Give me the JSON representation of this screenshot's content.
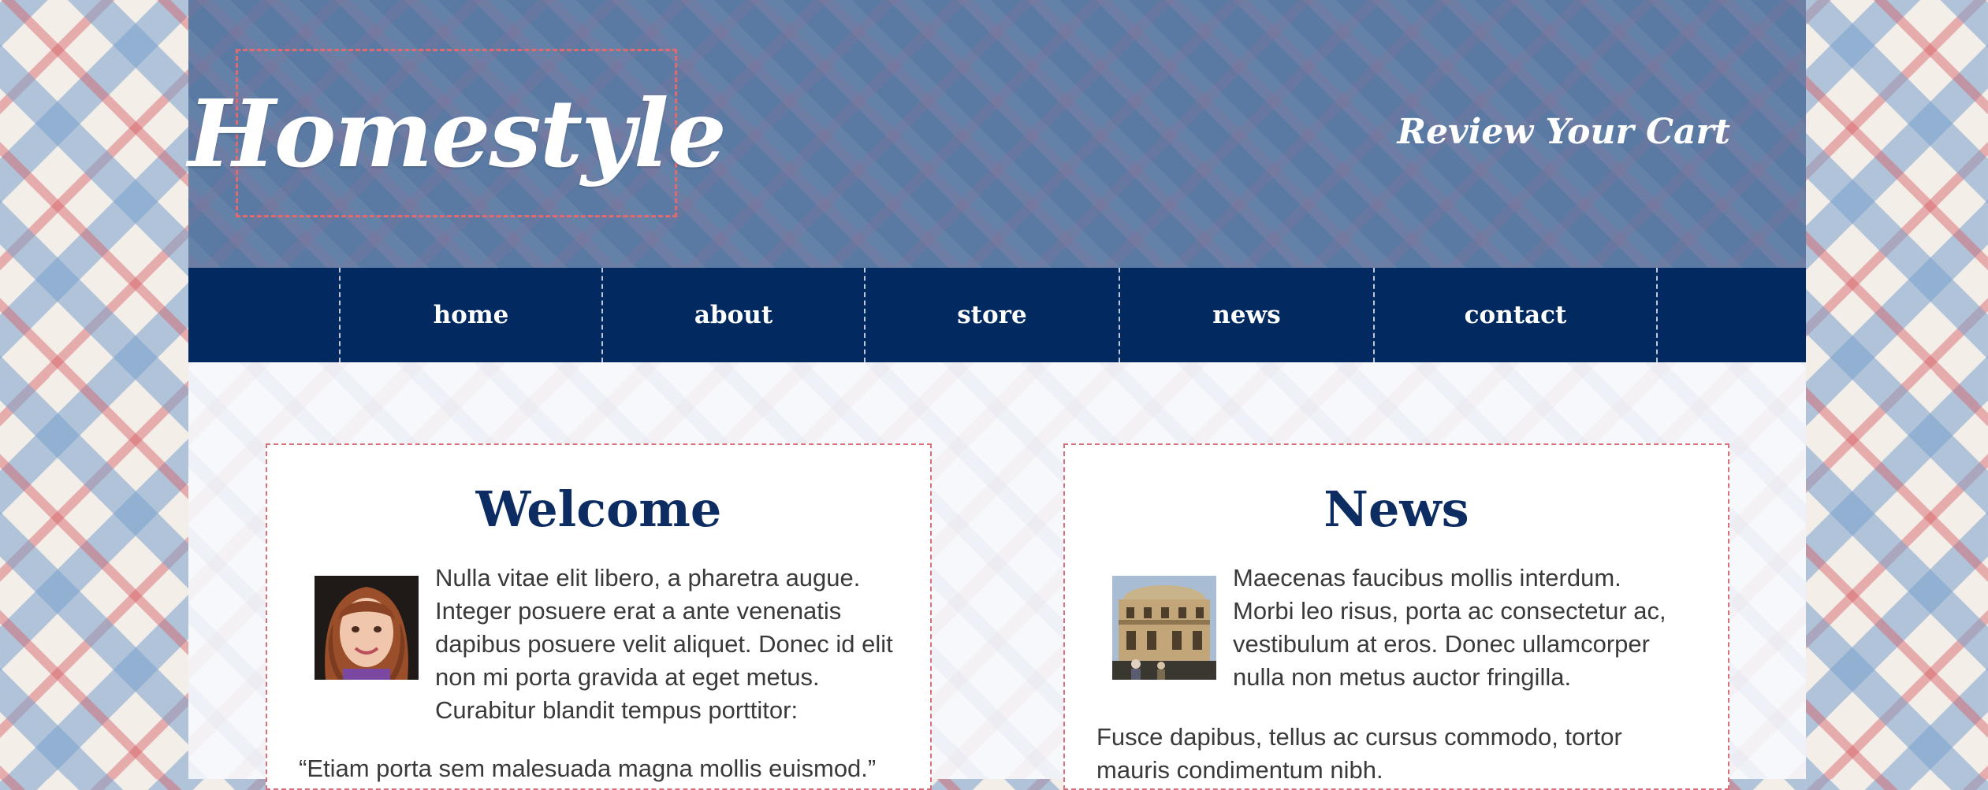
{
  "header": {
    "logo": "Homestyle",
    "cart_link": "Review Your Cart"
  },
  "nav": [
    {
      "label": "home"
    },
    {
      "label": "about"
    },
    {
      "label": "store"
    },
    {
      "label": "news"
    },
    {
      "label": "contact"
    }
  ],
  "welcome": {
    "title": "Welcome",
    "lines": [
      "Nulla vitae elit libero, a pharetra augue.",
      "Integer posuere erat a ante venenatis",
      "dapibus posuere velit aliquet. Donec id elit",
      "non mi porta gravida at eget metus.",
      "Curabitur blandit tempus porttitor:"
    ],
    "quote": "“Etiam porta sem malesuada magna mollis euismod.”",
    "image": "portrait-photo"
  },
  "news": {
    "title": "News",
    "lines": [
      "Maecenas faucibus mollis interdum.",
      "Morbi leo risus, porta ac consectetur ac,",
      "vestibulum at eros. Donec ullamcorper",
      "nulla non metus auctor fringilla."
    ],
    "para2": [
      "Fusce dapibus, tellus ac cursus commodo, tortor",
      "mauris condimentum nibh."
    ],
    "image": "building-photo"
  },
  "colors": {
    "header_blue": "#5a7aa3",
    "nav_navy": "#022a60",
    "accent_red": "#e06a72",
    "heading_navy": "#0d2d62"
  }
}
